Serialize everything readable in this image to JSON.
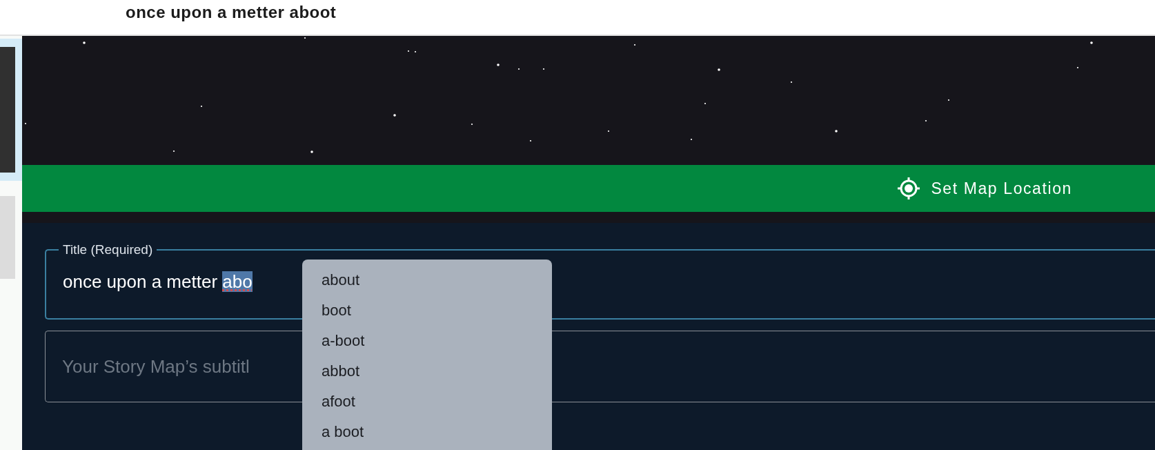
{
  "header": {
    "title": "once upon a metter aboot"
  },
  "sidebar": {
    "items": [
      {
        "kind": "thumbnail",
        "selected": true
      },
      {
        "kind": "placeholder",
        "selected": false
      }
    ]
  },
  "banner": {
    "kind": "picture",
    "button": {
      "label": "Set Map Location"
    }
  },
  "form": {
    "title_field": {
      "label": "Title (Required)",
      "value": "once upon a metter ",
      "selected_text": "abo",
      "focused": true
    },
    "subtitle_field": {
      "placeholder": "Your Story Map’s subtitl",
      "focused": false
    }
  },
  "suggestions": [
    {
      "label": "about"
    },
    {
      "label": "boot"
    },
    {
      "label": "a-boot"
    },
    {
      "label": "abbot"
    },
    {
      "label": "afoot"
    },
    {
      "label": "a boot"
    }
  ]
}
